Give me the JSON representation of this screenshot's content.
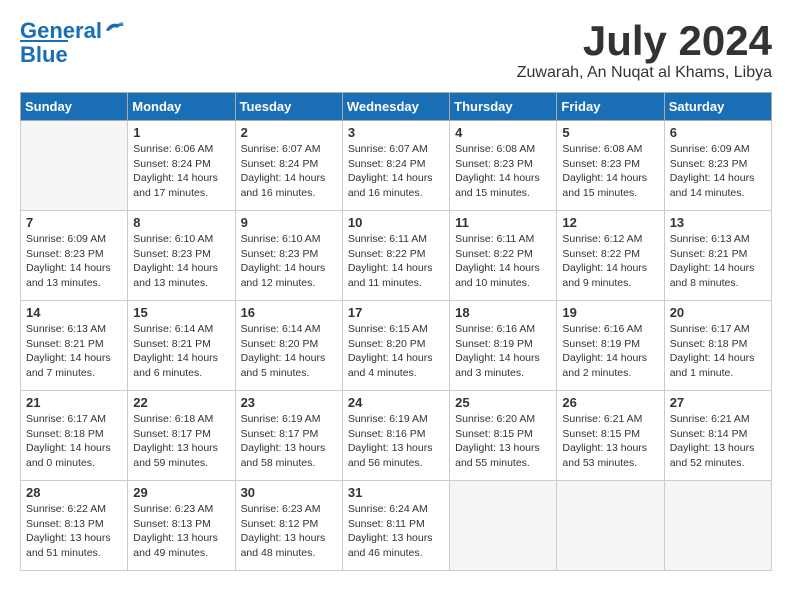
{
  "header": {
    "logo_line1": "General",
    "logo_line2": "Blue",
    "month": "July 2024",
    "location": "Zuwarah, An Nuqat al Khams, Libya"
  },
  "weekdays": [
    "Sunday",
    "Monday",
    "Tuesday",
    "Wednesday",
    "Thursday",
    "Friday",
    "Saturday"
  ],
  "weeks": [
    [
      {
        "day": "",
        "info": ""
      },
      {
        "day": "1",
        "info": "Sunrise: 6:06 AM\nSunset: 8:24 PM\nDaylight: 14 hours\nand 17 minutes."
      },
      {
        "day": "2",
        "info": "Sunrise: 6:07 AM\nSunset: 8:24 PM\nDaylight: 14 hours\nand 16 minutes."
      },
      {
        "day": "3",
        "info": "Sunrise: 6:07 AM\nSunset: 8:24 PM\nDaylight: 14 hours\nand 16 minutes."
      },
      {
        "day": "4",
        "info": "Sunrise: 6:08 AM\nSunset: 8:23 PM\nDaylight: 14 hours\nand 15 minutes."
      },
      {
        "day": "5",
        "info": "Sunrise: 6:08 AM\nSunset: 8:23 PM\nDaylight: 14 hours\nand 15 minutes."
      },
      {
        "day": "6",
        "info": "Sunrise: 6:09 AM\nSunset: 8:23 PM\nDaylight: 14 hours\nand 14 minutes."
      }
    ],
    [
      {
        "day": "7",
        "info": "Sunrise: 6:09 AM\nSunset: 8:23 PM\nDaylight: 14 hours\nand 13 minutes."
      },
      {
        "day": "8",
        "info": "Sunrise: 6:10 AM\nSunset: 8:23 PM\nDaylight: 14 hours\nand 13 minutes."
      },
      {
        "day": "9",
        "info": "Sunrise: 6:10 AM\nSunset: 8:23 PM\nDaylight: 14 hours\nand 12 minutes."
      },
      {
        "day": "10",
        "info": "Sunrise: 6:11 AM\nSunset: 8:22 PM\nDaylight: 14 hours\nand 11 minutes."
      },
      {
        "day": "11",
        "info": "Sunrise: 6:11 AM\nSunset: 8:22 PM\nDaylight: 14 hours\nand 10 minutes."
      },
      {
        "day": "12",
        "info": "Sunrise: 6:12 AM\nSunset: 8:22 PM\nDaylight: 14 hours\nand 9 minutes."
      },
      {
        "day": "13",
        "info": "Sunrise: 6:13 AM\nSunset: 8:21 PM\nDaylight: 14 hours\nand 8 minutes."
      }
    ],
    [
      {
        "day": "14",
        "info": "Sunrise: 6:13 AM\nSunset: 8:21 PM\nDaylight: 14 hours\nand 7 minutes."
      },
      {
        "day": "15",
        "info": "Sunrise: 6:14 AM\nSunset: 8:21 PM\nDaylight: 14 hours\nand 6 minutes."
      },
      {
        "day": "16",
        "info": "Sunrise: 6:14 AM\nSunset: 8:20 PM\nDaylight: 14 hours\nand 5 minutes."
      },
      {
        "day": "17",
        "info": "Sunrise: 6:15 AM\nSunset: 8:20 PM\nDaylight: 14 hours\nand 4 minutes."
      },
      {
        "day": "18",
        "info": "Sunrise: 6:16 AM\nSunset: 8:19 PM\nDaylight: 14 hours\nand 3 minutes."
      },
      {
        "day": "19",
        "info": "Sunrise: 6:16 AM\nSunset: 8:19 PM\nDaylight: 14 hours\nand 2 minutes."
      },
      {
        "day": "20",
        "info": "Sunrise: 6:17 AM\nSunset: 8:18 PM\nDaylight: 14 hours\nand 1 minute."
      }
    ],
    [
      {
        "day": "21",
        "info": "Sunrise: 6:17 AM\nSunset: 8:18 PM\nDaylight: 14 hours\nand 0 minutes."
      },
      {
        "day": "22",
        "info": "Sunrise: 6:18 AM\nSunset: 8:17 PM\nDaylight: 13 hours\nand 59 minutes."
      },
      {
        "day": "23",
        "info": "Sunrise: 6:19 AM\nSunset: 8:17 PM\nDaylight: 13 hours\nand 58 minutes."
      },
      {
        "day": "24",
        "info": "Sunrise: 6:19 AM\nSunset: 8:16 PM\nDaylight: 13 hours\nand 56 minutes."
      },
      {
        "day": "25",
        "info": "Sunrise: 6:20 AM\nSunset: 8:15 PM\nDaylight: 13 hours\nand 55 minutes."
      },
      {
        "day": "26",
        "info": "Sunrise: 6:21 AM\nSunset: 8:15 PM\nDaylight: 13 hours\nand 53 minutes."
      },
      {
        "day": "27",
        "info": "Sunrise: 6:21 AM\nSunset: 8:14 PM\nDaylight: 13 hours\nand 52 minutes."
      }
    ],
    [
      {
        "day": "28",
        "info": "Sunrise: 6:22 AM\nSunset: 8:13 PM\nDaylight: 13 hours\nand 51 minutes."
      },
      {
        "day": "29",
        "info": "Sunrise: 6:23 AM\nSunset: 8:13 PM\nDaylight: 13 hours\nand 49 minutes."
      },
      {
        "day": "30",
        "info": "Sunrise: 6:23 AM\nSunset: 8:12 PM\nDaylight: 13 hours\nand 48 minutes."
      },
      {
        "day": "31",
        "info": "Sunrise: 6:24 AM\nSunset: 8:11 PM\nDaylight: 13 hours\nand 46 minutes."
      },
      {
        "day": "",
        "info": ""
      },
      {
        "day": "",
        "info": ""
      },
      {
        "day": "",
        "info": ""
      }
    ]
  ]
}
